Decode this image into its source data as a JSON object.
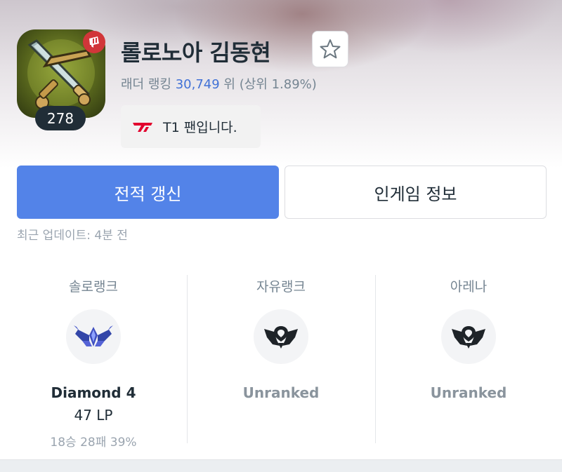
{
  "profile": {
    "level": "278",
    "summoner_name": "롤로노아 김동현",
    "icon_name": "crossed-swords-profile-icon"
  },
  "ladder": {
    "prefix": "래더 랭킹",
    "rank": "30,749",
    "suffix": "위 (상위 1.89%)"
  },
  "fan_badge": {
    "text": "T1 팬입니다."
  },
  "actions": {
    "refresh_label": "전적 갱신",
    "ingame_label": "인게임 정보"
  },
  "last_update": "최근 업데이트: 4분 전",
  "ranks": [
    {
      "queue": "솔로랭크",
      "tier": "Diamond 4",
      "lp": "47 LP",
      "record": "18승 28패 39%",
      "emblem": "diamond-emblem-icon"
    },
    {
      "queue": "자유랭크",
      "tier": "Unranked",
      "emblem": "unranked-emblem-icon"
    },
    {
      "queue": "아레나",
      "tier": "Unranked",
      "emblem": "unranked-emblem-icon"
    }
  ],
  "colors": {
    "primary": "#5383e8",
    "rank_link": "#4171d6",
    "riot_red": "#d13639",
    "text_dark": "#202d37",
    "text_muted": "#758592"
  }
}
